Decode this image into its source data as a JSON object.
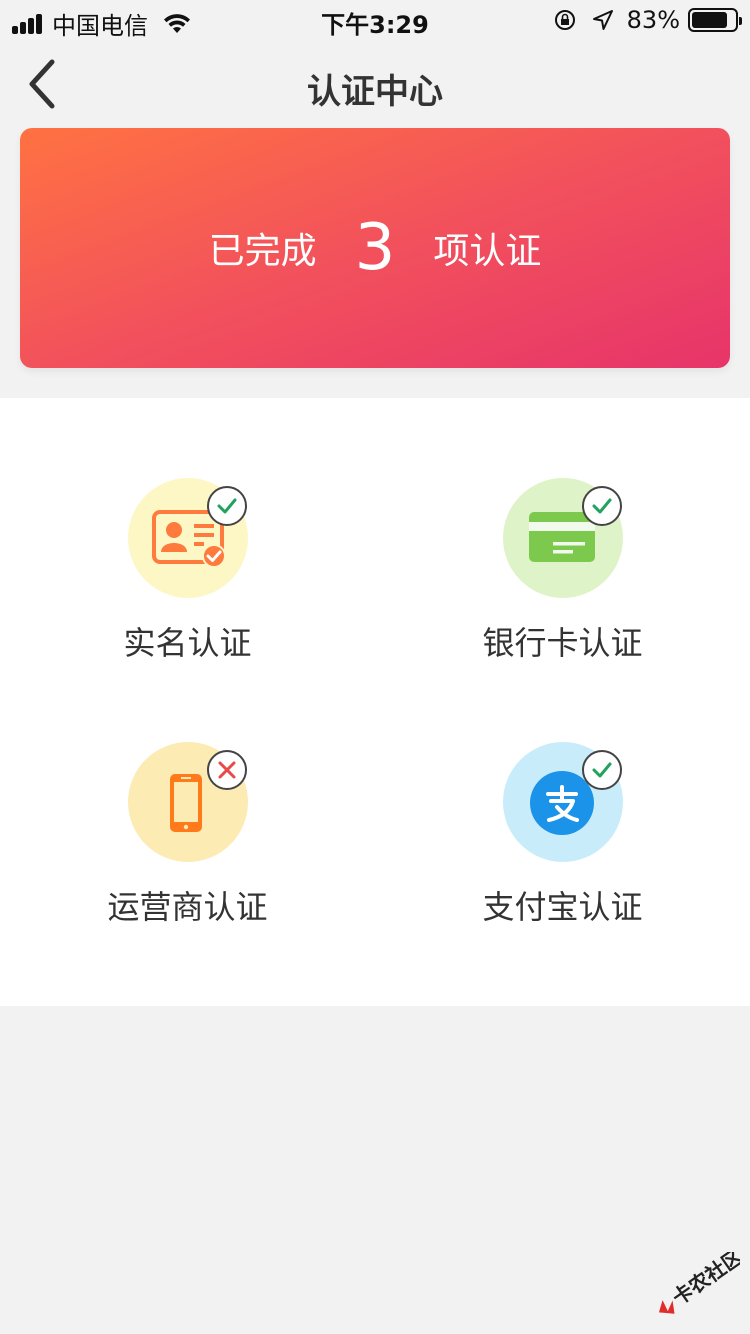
{
  "status_bar": {
    "carrier": "中国电信",
    "time": "下午3:29",
    "battery": "83%",
    "battery_level": 0.83
  },
  "nav": {
    "title": "认证中心"
  },
  "banner": {
    "prefix": "已完成",
    "count": "3",
    "suffix": "项认证"
  },
  "items": [
    {
      "label": "实名认证",
      "icon": "id-card-icon",
      "status": "verified",
      "circle_color": "#fdf7c6",
      "icon_color": "#ff7a3d"
    },
    {
      "label": "银行卡认证",
      "icon": "bank-card-icon",
      "status": "verified",
      "circle_color": "#dff3c9",
      "icon_color": "#7cc94e"
    },
    {
      "label": "运营商认证",
      "icon": "phone-icon",
      "status": "unverified",
      "circle_color": "#fdebb4",
      "icon_color": "#ff7a1a"
    },
    {
      "label": "支付宝认证",
      "icon": "alipay-icon",
      "status": "verified",
      "circle_color": "#c9ecfb",
      "icon_color": "#1a93e8"
    }
  ],
  "colors": {
    "verified": "#22a25d",
    "unverified": "#e84a4a",
    "banner_start": "#ff7242",
    "banner_end": "#e7346a"
  },
  "watermark": {
    "text": "卡农社区"
  }
}
